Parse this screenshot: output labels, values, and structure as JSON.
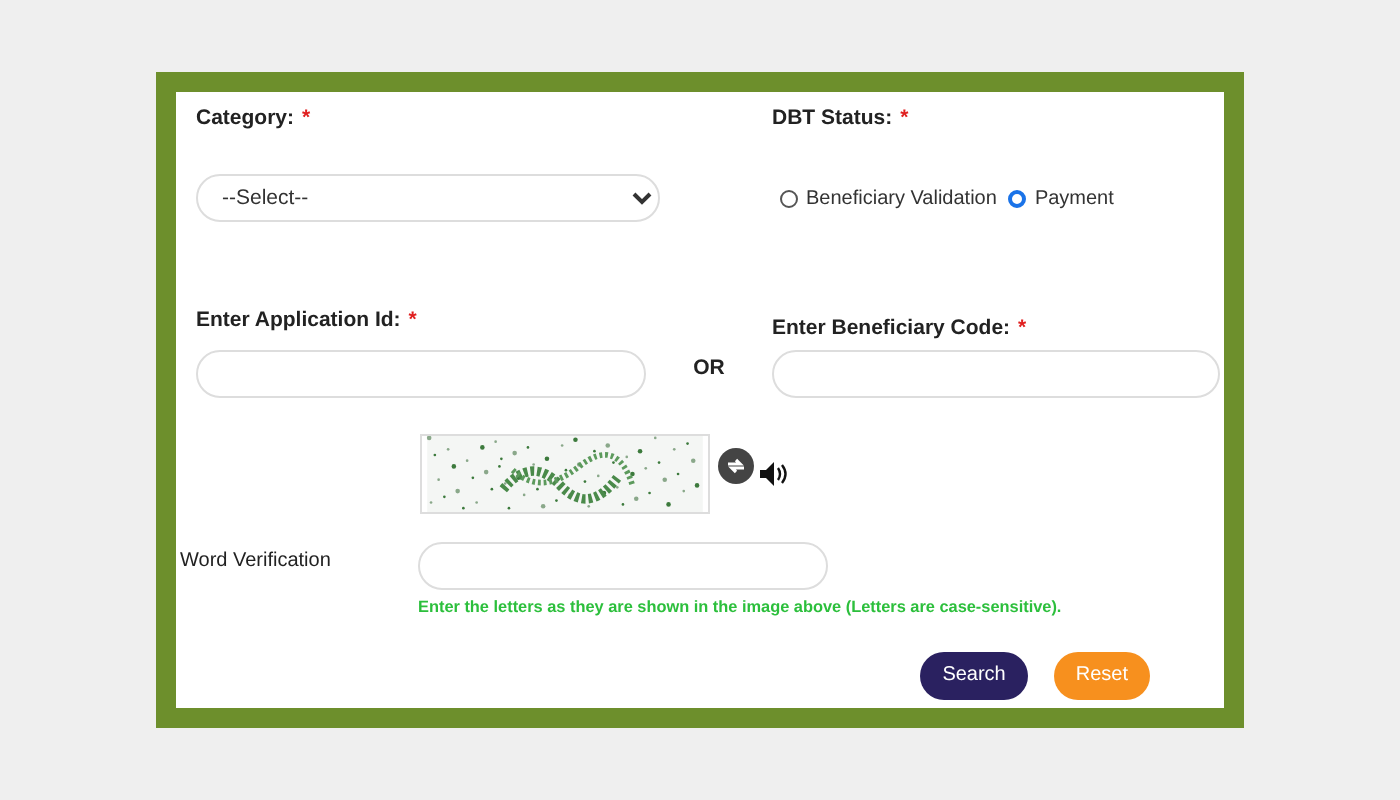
{
  "category": {
    "label": "Category:",
    "required_mark": "*",
    "value": "--Select--"
  },
  "dbt_status": {
    "label": "DBT Status:",
    "required_mark": "*",
    "options": [
      {
        "label": "Beneficiary Validation",
        "selected": false
      },
      {
        "label": "Payment",
        "selected": true
      }
    ]
  },
  "application_id": {
    "label": "Enter Application Id:",
    "required_mark": "*"
  },
  "separator": "OR",
  "beneficiary_code": {
    "label": "Enter Beneficiary Code:",
    "required_mark": "*"
  },
  "word_verification": {
    "label": "Word Verification",
    "hint": "Enter the letters as they are shown in the image above (Letters are case-sensitive)."
  },
  "buttons": [
    {
      "label": "Search",
      "kind": "primary"
    },
    {
      "label": "Reset",
      "kind": "secondary"
    }
  ]
}
